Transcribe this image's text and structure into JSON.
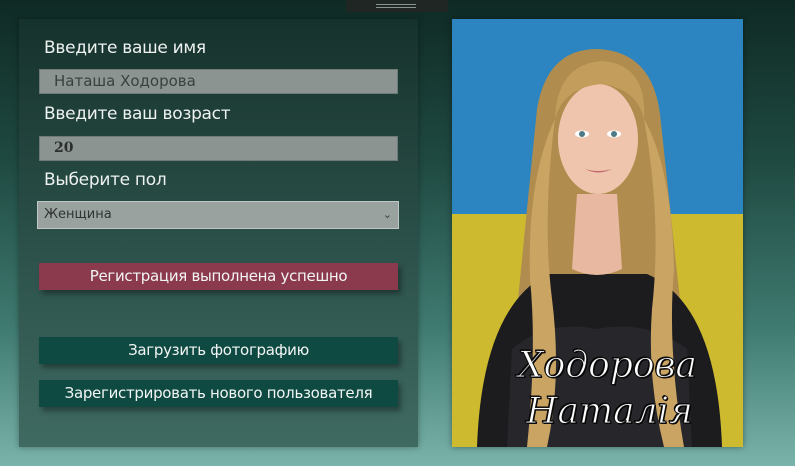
{
  "form": {
    "name_label": "Введите ваше имя",
    "name_value": "Наташа Ходорова",
    "age_label": "Введите ваш возраст",
    "age_value": "20",
    "gender_label": "Выберите пол",
    "gender_value": "Женщина",
    "status_text": "Регистрация выполнена успешно",
    "upload_label": "Загрузить фотографию",
    "register_label": "Зарегистрировать нового пользователя"
  },
  "photo": {
    "caption_line1": "Ходорова",
    "caption_line2": "Наталія"
  },
  "icons": {
    "select_chevron": "chevron-down-icon"
  },
  "colors": {
    "status_button": "#8b3a4e",
    "action_button": "#0f4a42",
    "flag_blue": "#2f8fd0",
    "flag_yellow": "#e8cc2a"
  }
}
